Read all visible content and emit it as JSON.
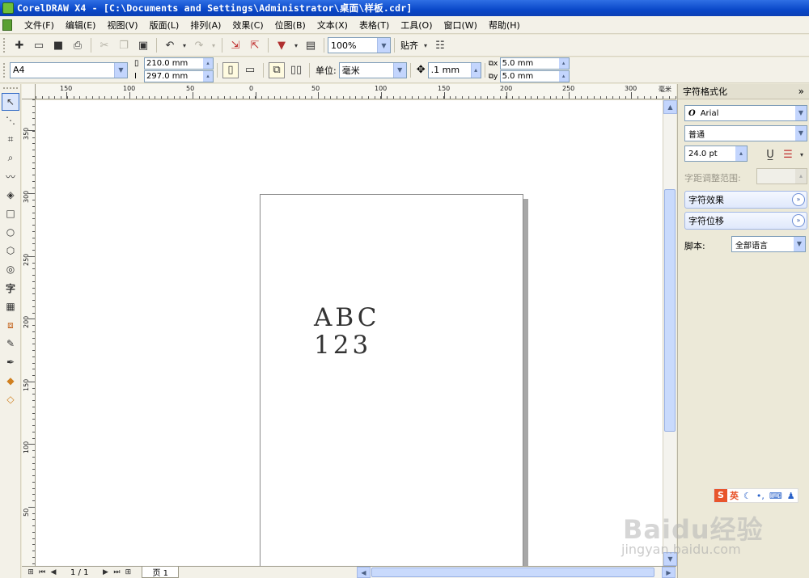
{
  "window": {
    "title": "CorelDRAW X4 - [C:\\Documents and Settings\\Administrator\\桌面\\样板.cdr]"
  },
  "menu": [
    "文件(F)",
    "编辑(E)",
    "视图(V)",
    "版面(L)",
    "排列(A)",
    "效果(C)",
    "位图(B)",
    "文本(X)",
    "表格(T)",
    "工具(O)",
    "窗口(W)",
    "帮助(H)"
  ],
  "standard_toolbar": {
    "zoom": "100%",
    "snap_label": "贴齐"
  },
  "property_bar": {
    "paper_size": "A4",
    "width": "210.0 mm",
    "height": "297.0 mm",
    "units_label": "单位:",
    "units": "毫米",
    "nudge": ".1 mm",
    "dup_x": "5.0 mm",
    "dup_y": "5.0 mm"
  },
  "ruler": {
    "h_labels": [
      "150",
      "100",
      "50",
      "0",
      "50",
      "100",
      "150",
      "200",
      "250",
      "300"
    ],
    "h_unit": "毫米",
    "v_labels": [
      "350",
      "300",
      "250",
      "200",
      "150",
      "100",
      "50"
    ]
  },
  "canvas": {
    "line1": "ABC",
    "line2": "123"
  },
  "statusbar": {
    "page_counter": "1 / 1",
    "page_tab": "页 1"
  },
  "docker": {
    "title": "字符格式化",
    "font": "Arial",
    "style": "普通",
    "size": "24.0 pt",
    "kerning_label": "字距调整范围:",
    "section_effects": "字符效果",
    "section_shift": "字符位移",
    "script_label": "脚本:",
    "script_value": "全部语言"
  },
  "ime": {
    "mode": "英"
  },
  "watermark": {
    "main": "Baidu经验",
    "sub": "jingyan.baidu.com"
  }
}
